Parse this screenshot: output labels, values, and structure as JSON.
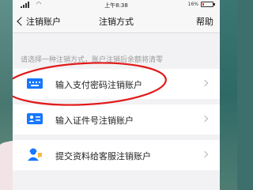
{
  "status_bar": {
    "time": "上午8:38",
    "battery_text": "16%",
    "battery_level": 0.16,
    "battery_color": "#e53935"
  },
  "nav": {
    "back_label": "注销账户",
    "title": "注销方式",
    "help_label": "帮助"
  },
  "hint_text": "请选择一种注销方式，账户注销后余额将清零",
  "options": [
    {
      "label": "输入支付密码注销账户",
      "icon": "keyboard-icon",
      "highlighted": true
    },
    {
      "label": "输入证件号注销账户",
      "icon": "id-card-icon"
    },
    {
      "label": "提交资料给客服注销账户",
      "icon": "customer-service-icon"
    }
  ],
  "colors": {
    "accent_blue": "#1677ff",
    "highlight_circle": "#e21a1a"
  }
}
